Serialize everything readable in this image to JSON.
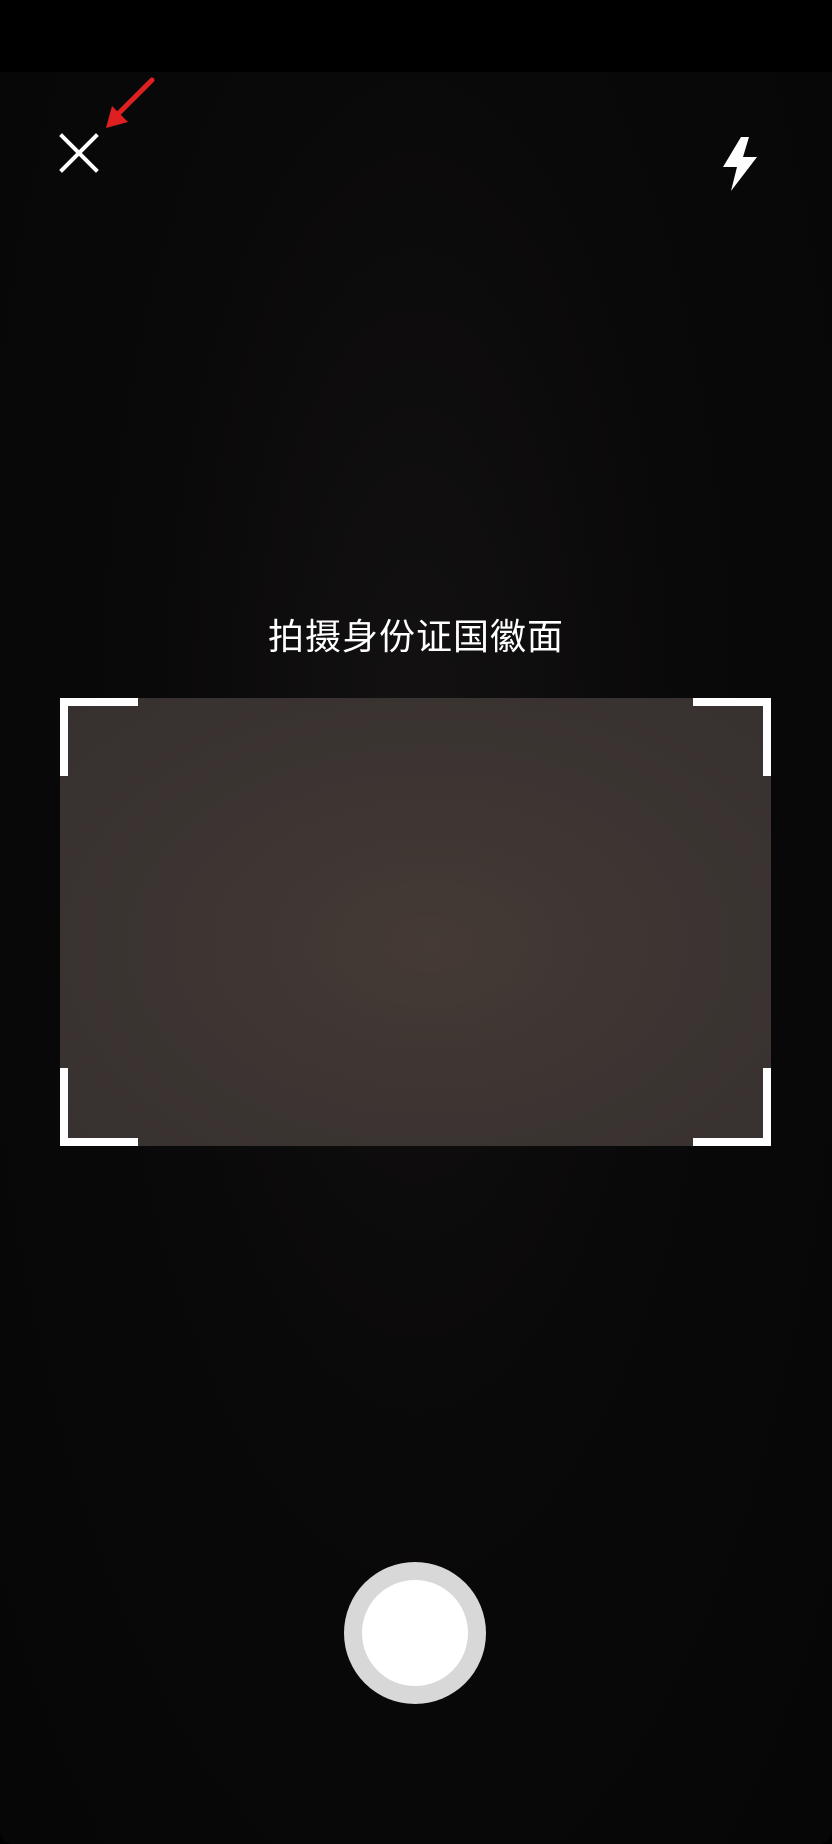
{
  "camera": {
    "instruction": "拍摄身份证国徽面"
  },
  "controls": {
    "close_icon": "close-icon",
    "flash_icon": "flash-icon",
    "shutter": "shutter-button"
  },
  "colors": {
    "background": "#000000",
    "scan_area": "#3c3532",
    "frame_corners": "#ffffff",
    "shutter_ring": "#d8d8d8",
    "annotation_arrow": "#e02020"
  }
}
